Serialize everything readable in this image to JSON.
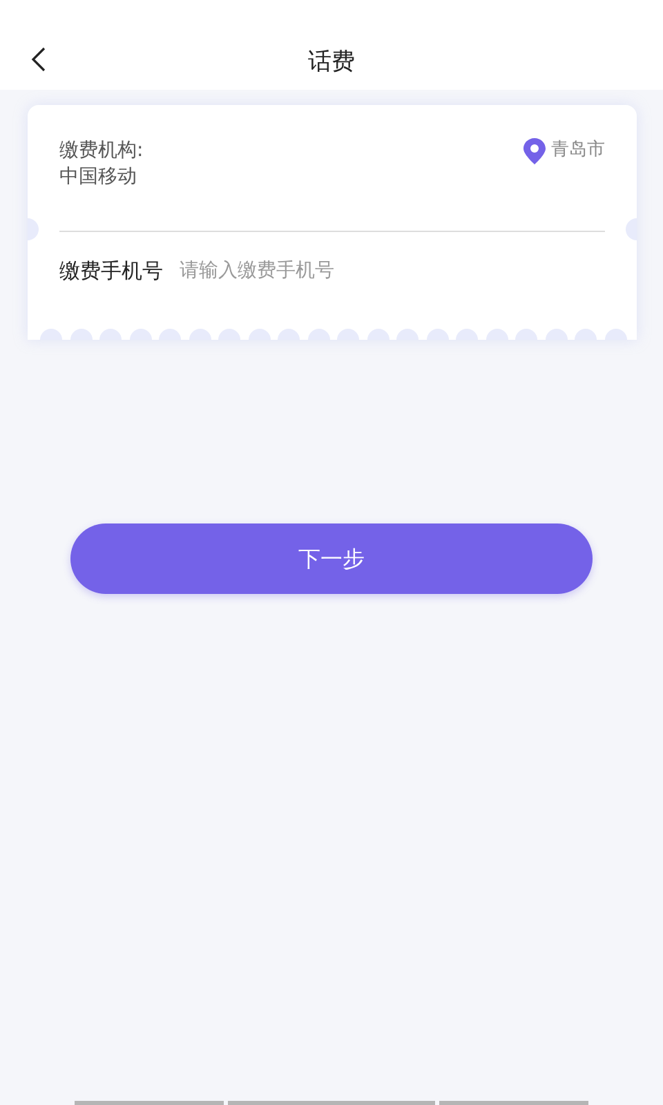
{
  "header": {
    "title": "话费"
  },
  "card": {
    "org_label": "缴费机构:",
    "org_value": "中国移动",
    "city": "青岛市",
    "phone_label": "缴费手机号",
    "phone_placeholder": "请输入缴费手机号"
  },
  "next_button": "下一步"
}
